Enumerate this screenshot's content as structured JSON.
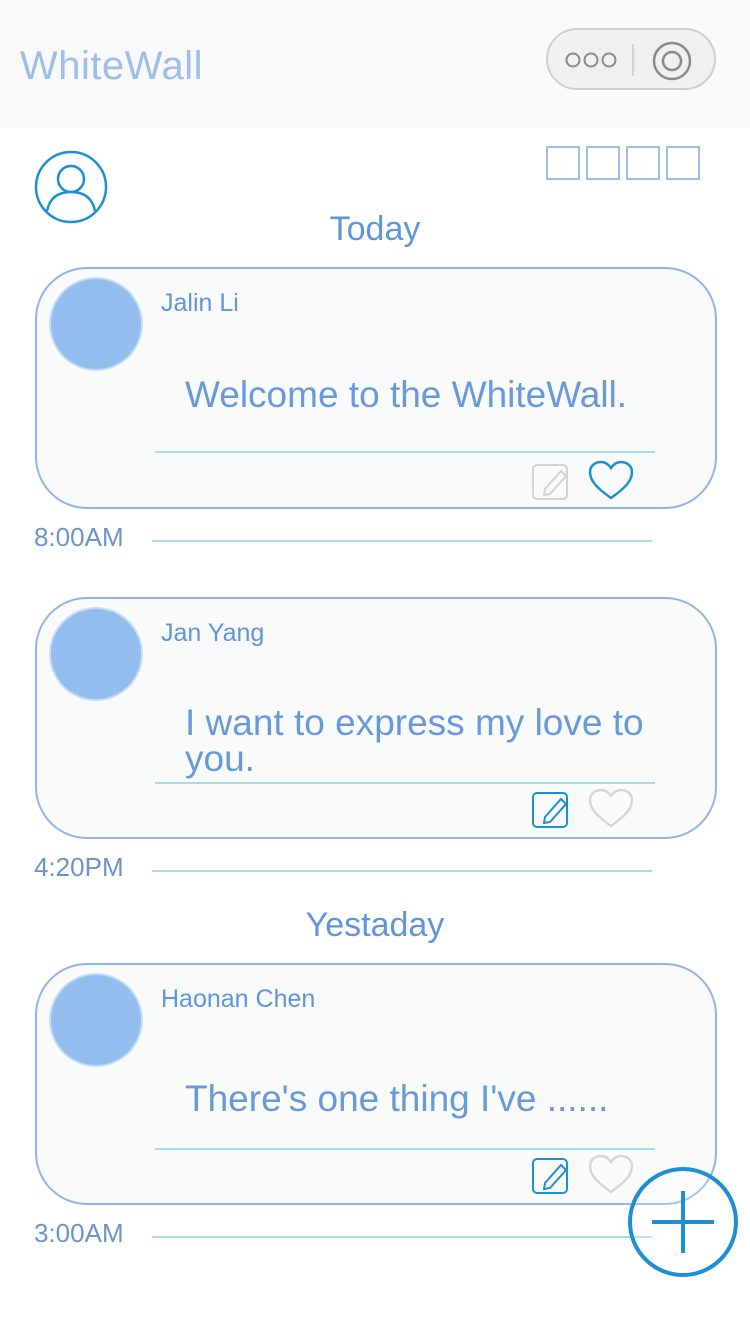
{
  "app": {
    "title": "WhiteWall"
  },
  "sections": [
    {
      "heading": "Today"
    },
    {
      "heading": "Yestaday"
    }
  ],
  "posts": [
    {
      "author": "Jalin Li",
      "message": "Welcome to the WhiteWall.",
      "time": "8:00AM",
      "liked": true,
      "edit_active": false
    },
    {
      "author": "Jan Yang",
      "message": "I want to express my love to you.",
      "time": "4:20PM",
      "liked": false,
      "edit_active": true
    },
    {
      "author": "Haonan Chen",
      "message": "There's one thing I've ......",
      "time": "3:00AM",
      "liked": false,
      "edit_active": true
    }
  ],
  "colors": {
    "accent": "#1e8fd4",
    "title": "#9dbfe9",
    "card_border": "#93b3ee",
    "avatar": "#94bdef",
    "line": "#a9dbe9"
  },
  "icons": {
    "more": "more-icon",
    "close_target": "target-icon",
    "user": "user-icon",
    "grid": "grid-icon",
    "edit": "edit-icon",
    "like": "heart-icon",
    "add": "add-icon"
  }
}
